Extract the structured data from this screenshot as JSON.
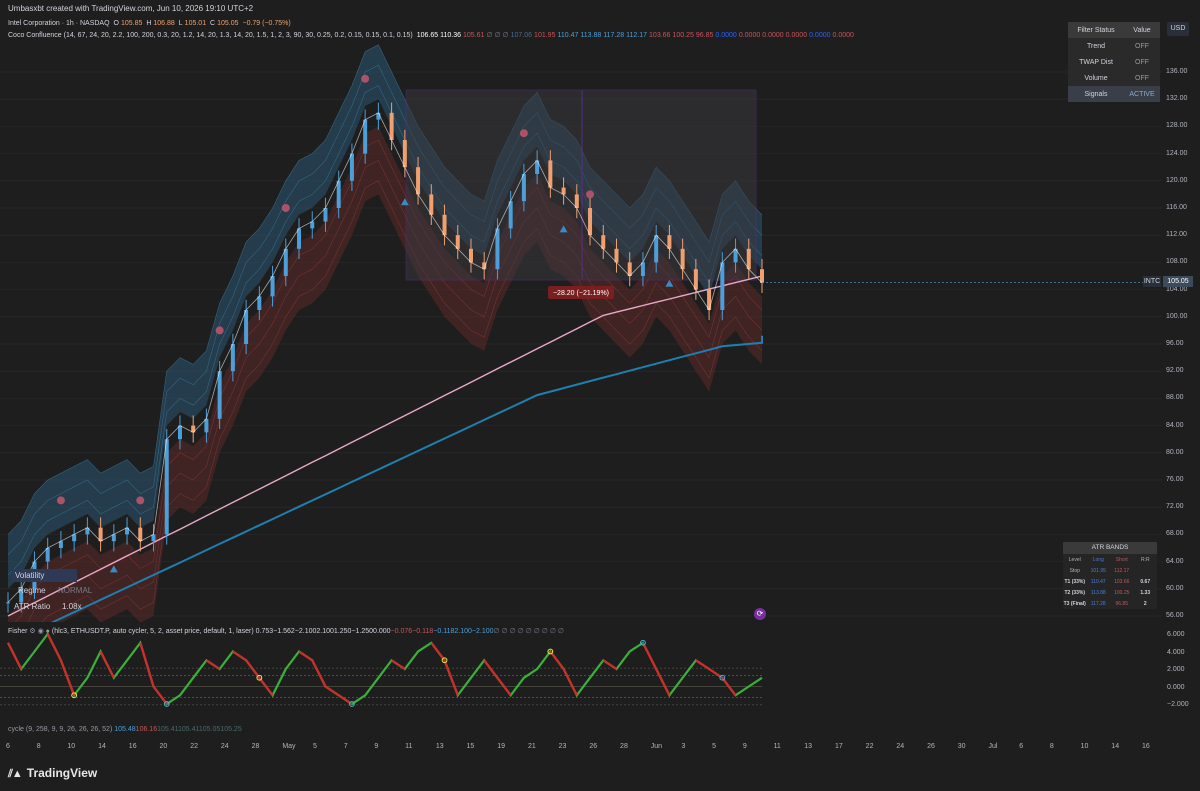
{
  "caption": "Umbasxbt created with TradingView.com, Jun 10, 2026 19:10 UTC+2",
  "symbol_legend": {
    "title": "Intel Corporation · 1h · NASDAQ",
    "o_label": "O",
    "o": "105.85",
    "h_label": "H",
    "h": "106.88",
    "l_label": "L",
    "l": "105.01",
    "c_label": "C",
    "c": "105.05",
    "change": "−0.79 (−0.75%)"
  },
  "indicator_legend": {
    "name": "Coco Confluence (14, 67, 24, 20, 2.2, 100, 200, 0.3, 20, 1.2, 14, 20, 1.3, 14, 20, 1.5, 1, 2, 3, 90, 30, 0.25, 0.2, 0.15, 0.15, 0.1, 0.15)",
    "values": [
      {
        "v": "106.65",
        "color": "#ffffff"
      },
      {
        "v": "110.36",
        "color": "#ffffff"
      },
      {
        "v": "105.61",
        "color": "#c4565c"
      },
      {
        "v": "∅ ∅ ∅",
        "color": "#787b86"
      },
      {
        "v": "107.06",
        "color": "#4a6a8a"
      },
      {
        "v": "101.95",
        "color": "#c4565c"
      },
      {
        "v": "110.47",
        "color": "#4c9fd9"
      },
      {
        "v": "113.88",
        "color": "#4c9fd9"
      },
      {
        "v": "117.28",
        "color": "#4c9fd9"
      },
      {
        "v": "112.17",
        "color": "#4c9fd9"
      },
      {
        "v": "103.66",
        "color": "#c4565c"
      },
      {
        "v": "100.25",
        "color": "#c4565c"
      },
      {
        "v": "96.85",
        "color": "#c4565c"
      },
      {
        "v": "0.0000",
        "color": "#2962ff"
      },
      {
        "v": "0.0000",
        "color": "#c4565c"
      },
      {
        "v": "0.0000",
        "color": "#c4565c"
      },
      {
        "v": "0.0000",
        "color": "#c4565c"
      },
      {
        "v": "0.0000",
        "color": "#2962ff"
      },
      {
        "v": "0.0000",
        "color": "#c4565c"
      }
    ]
  },
  "price_axis": {
    "currency": "USD",
    "ticks": [
      "136.00",
      "132.00",
      "128.00",
      "124.00",
      "120.00",
      "116.00",
      "112.00",
      "108.00",
      "104.00",
      "100.00",
      "96.00",
      "92.00",
      "88.00",
      "84.00",
      "80.00",
      "76.00",
      "72.00",
      "68.00",
      "64.00",
      "60.00",
      "56.00"
    ],
    "last_symbol": "INTC",
    "last_price": "105.05"
  },
  "filter_table": {
    "header": [
      "Filter Status",
      "Value"
    ],
    "rows": [
      {
        "name": "Trend",
        "value": "OFF"
      },
      {
        "name": "TWAP Dist",
        "value": "OFF"
      },
      {
        "name": "Volume",
        "value": "OFF"
      },
      {
        "name": "Signals",
        "value": "ACTIVE"
      }
    ]
  },
  "measure_label": "−28.20 (−21.19%)",
  "atr_table": {
    "title": "ATR BANDS",
    "header": [
      "Level",
      "Long",
      "Short",
      "R:R"
    ],
    "rows": [
      {
        "level": "Stop",
        "long": "101.95",
        "short": "112.17",
        "rr": ""
      },
      {
        "level": "T1 (33%)",
        "long": "110.47",
        "short": "103.66",
        "rr": "0.67"
      },
      {
        "level": "T2 (33%)",
        "long": "113.88",
        "short": "100.25",
        "rr": "1.33"
      },
      {
        "level": "T3 (Final)",
        "long": "117.28",
        "short": "96.85",
        "rr": "2"
      }
    ]
  },
  "volatility_box": {
    "title": "Volatility",
    "regime_label": "Regime",
    "regime_value": "NORMAL",
    "atr_label": "ATR Ratio",
    "atr_value": "1.08x"
  },
  "fisher_legend": {
    "name": "Fisher",
    "params": "(hlc3, ETHUSDT.P, auto cycler, 5, 2, asset price, default, 1, laser)",
    "values": [
      {
        "v": "0.753",
        "color": "#d1d4dc"
      },
      {
        "v": "−1.562",
        "color": "#d1d4dc"
      },
      {
        "v": "−2.100",
        "color": "#d1d4dc"
      },
      {
        "v": "2.100",
        "color": "#d1d4dc"
      },
      {
        "v": "1.250",
        "color": "#d1d4dc"
      },
      {
        "v": "−1.250",
        "color": "#d1d4dc"
      },
      {
        "v": "0.000",
        "color": "#d1d4dc"
      },
      {
        "v": "−0.076",
        "color": "#c4565c"
      },
      {
        "v": "−0.118",
        "color": "#c4565c"
      },
      {
        "v": "−0.118",
        "color": "#4c9fd9"
      },
      {
        "v": "2.100",
        "color": "#4c9fd9"
      },
      {
        "v": "−2.100",
        "color": "#4c9fd9"
      },
      {
        "v": "∅ ∅ ∅ ∅ ∅ ∅ ∅ ∅ ∅",
        "color": "#787b86"
      }
    ]
  },
  "osc_axis": {
    "ticks": [
      "6.000",
      "4.000",
      "2.000",
      "0.000",
      "−2.000"
    ]
  },
  "cycle_legend": {
    "name": "cycle (9, 258, 9, 9, 26, 26, 26, 52)",
    "values": [
      {
        "v": "105.48",
        "color": "#4c9fd9"
      },
      {
        "v": "106.16",
        "color": "#c4565c"
      },
      {
        "v": "105.41",
        "color": "#4a6a6a"
      },
      {
        "v": "105.41",
        "color": "#4a6a6a"
      },
      {
        "v": "105.05",
        "color": "#4a6a6a"
      },
      {
        "v": "105.25",
        "color": "#4a6a6a"
      }
    ]
  },
  "time_axis": {
    "ticks": [
      "6",
      "8",
      "10",
      "14",
      "16",
      "20",
      "22",
      "24",
      "28",
      "May",
      "5",
      "7",
      "9",
      "11",
      "13",
      "15",
      "19",
      "21",
      "23",
      "26",
      "28",
      "Jun",
      "3",
      "5",
      "9",
      "11",
      "13",
      "17",
      "22",
      "24",
      "26",
      "30",
      "Jul",
      "6",
      "8",
      "10",
      "14",
      "16"
    ]
  },
  "brand": "TradingView",
  "colors": {
    "background": "#1e1e1e",
    "bull": "#4c9fd9",
    "bear": "#f0a070",
    "band_blue": "#2a5a78",
    "band_red": "#6a2a2a",
    "slow_ma": "#1f7fb0",
    "pink_ma": "#e8a8c8",
    "box": "#5a2d8a"
  },
  "chart_data": {
    "type": "line",
    "title": "Intel Corporation · 1h · NASDAQ",
    "ylim": [
      54,
      138
    ],
    "series": [
      {
        "name": "Price",
        "values": [
          58,
          60,
          64,
          66,
          67,
          68,
          69,
          67,
          68,
          69,
          67,
          68,
          82,
          84,
          83,
          85,
          92,
          96,
          101,
          103,
          106,
          110,
          113,
          114,
          116,
          120,
          124,
          129,
          130,
          126,
          122,
          118,
          115,
          112,
          110,
          108,
          107,
          113,
          117,
          121,
          123,
          119,
          118,
          116,
          112,
          110,
          108,
          106,
          108,
          112,
          110,
          107,
          104,
          101,
          108,
          110,
          107,
          105
        ]
      }
    ]
  }
}
